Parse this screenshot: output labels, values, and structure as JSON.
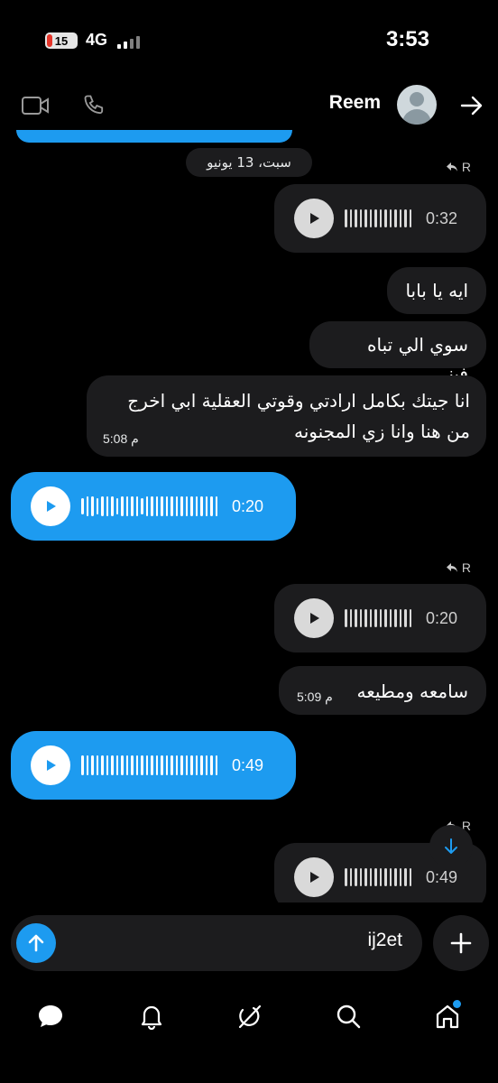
{
  "status_bar": {
    "battery": "15",
    "network": "4G",
    "time": "3:53"
  },
  "header": {
    "contact_name": "Reem",
    "icons": [
      "video-call-icon",
      "phone-icon",
      "avatar",
      "forward-arrow-icon"
    ]
  },
  "date_separator": "سبت، 13 يونيو",
  "messages": [
    {
      "type": "voice",
      "direction": "incoming",
      "duration": "0:32",
      "reply_label": "R"
    },
    {
      "type": "text",
      "direction": "incoming",
      "text": "ايه يا بابا"
    },
    {
      "type": "text",
      "direction": "incoming",
      "text": "سوي الي تباه فيني"
    },
    {
      "type": "text",
      "direction": "incoming",
      "line1": "انا جيتك بكامل ارادتي وقوتي العقلية ابي اخرج",
      "line2": "من هنا وانا زي المجنونه",
      "time": "5:08 م"
    },
    {
      "type": "voice",
      "direction": "outgoing",
      "duration": "0:20"
    },
    {
      "type": "voice",
      "direction": "incoming",
      "duration": "0:20",
      "reply_label": "R"
    },
    {
      "type": "text",
      "direction": "incoming",
      "text": "سامعه ومطيعه",
      "time": "5:09 م"
    },
    {
      "type": "voice",
      "direction": "outgoing",
      "duration": "0:49"
    },
    {
      "type": "voice",
      "direction": "incoming",
      "duration": "0:49",
      "reply_label": "R"
    }
  ],
  "composer": {
    "value": "ij2et"
  },
  "tabbar": {
    "items": [
      "messages-icon",
      "notifications-icon",
      "grok-icon",
      "search-icon",
      "home-icon"
    ],
    "active_indicator_on": "home-icon"
  },
  "colors": {
    "accent": "#1d9bf0",
    "bubble_incoming": "#1c1c1e",
    "background": "#000000"
  }
}
